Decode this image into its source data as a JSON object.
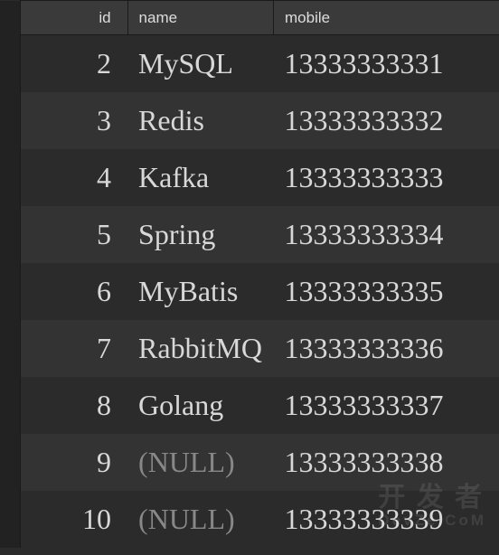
{
  "columns": {
    "id": "id",
    "name": "name",
    "mobile": "mobile"
  },
  "rows": [
    {
      "id": "2",
      "name": "MySQL",
      "mobile": "13333333331",
      "is_null_name": false
    },
    {
      "id": "3",
      "name": "Redis",
      "mobile": "13333333332",
      "is_null_name": false
    },
    {
      "id": "4",
      "name": "Kafka",
      "mobile": "13333333333",
      "is_null_name": false
    },
    {
      "id": "5",
      "name": "Spring",
      "mobile": "13333333334",
      "is_null_name": false
    },
    {
      "id": "6",
      "name": "MyBatis",
      "mobile": "13333333335",
      "is_null_name": false
    },
    {
      "id": "7",
      "name": "RabbitMQ",
      "mobile": "13333333336",
      "is_null_name": false
    },
    {
      "id": "8",
      "name": "Golang",
      "mobile": "13333333337",
      "is_null_name": false
    },
    {
      "id": "9",
      "name": "(NULL)",
      "mobile": "13333333338",
      "is_null_name": true
    },
    {
      "id": "10",
      "name": "(NULL)",
      "mobile": "13333333339",
      "is_null_name": true
    }
  ],
  "watermark": {
    "main": "开 发 者",
    "sub": "DevZe.CoM"
  }
}
